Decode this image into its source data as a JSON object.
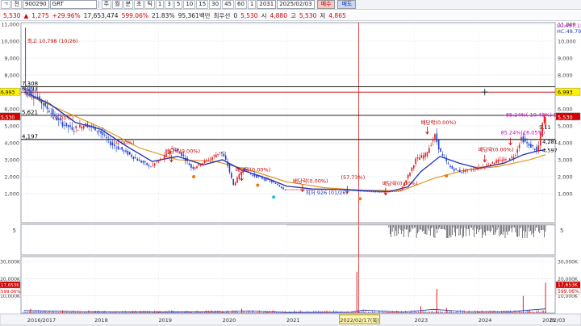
{
  "toolbar": {
    "items": [
      "ㄱ",
      "전",
      "900290",
      "GRT",
      "주",
      "월",
      "분",
      "초",
      "틱",
      "1",
      "3",
      "5",
      "10",
      "15",
      "30",
      "45",
      "60",
      "1",
      "2031",
      "2025/02/03"
    ],
    "trade_buy": "매수",
    "trade_sell": "매도"
  },
  "info": {
    "price": "5,530",
    "change": "1,275",
    "change_pct": "+29.96%",
    "volume": "17,653,474",
    "vol_ratio": "599.06%",
    "turnover": "21.83%",
    "amount": "95,361백만",
    "prio_label": "최우선",
    "prio_val": "0",
    "cur": "5,530",
    "open_label": "시",
    "open": "4,880",
    "high_label": "고",
    "high": "5,530",
    "low_label": "저",
    "low": "4,865"
  },
  "chart_data": {
    "type": "candlestick",
    "x_ticks": [
      "2016/2017",
      "2018",
      "2019",
      "2020",
      "2021",
      "2022/02/17(목)",
      "2023",
      "2024",
      "2025",
      "02/03"
    ],
    "y_ticks": [
      "11,000",
      "10,000",
      "9,000",
      "8,000",
      "7,000",
      "6,000",
      "5,000",
      "4,000",
      "3,000",
      "2,000",
      "1,000"
    ],
    "ylim": [
      0,
      11000
    ],
    "price_series": [
      [
        2016.9,
        7300
      ],
      [
        2017.1,
        6800
      ],
      [
        2017.3,
        6000
      ],
      [
        2017.5,
        5200
      ],
      [
        2017.7,
        4800
      ],
      [
        2017.9,
        5100
      ],
      [
        2018.1,
        4700
      ],
      [
        2018.3,
        3900
      ],
      [
        2018.5,
        3500
      ],
      [
        2018.7,
        3000
      ],
      [
        2018.9,
        2600
      ],
      [
        2019.1,
        3100
      ],
      [
        2019.25,
        3700
      ],
      [
        2019.4,
        3300
      ],
      [
        2019.55,
        2500
      ],
      [
        2019.7,
        2800
      ],
      [
        2019.85,
        3100
      ],
      [
        2020.0,
        3500
      ],
      [
        2020.1,
        2800
      ],
      [
        2020.2,
        1500
      ],
      [
        2020.35,
        2500
      ],
      [
        2020.5,
        2100
      ],
      [
        2020.65,
        1900
      ],
      [
        2020.8,
        1700
      ],
      [
        2020.9,
        1500
      ],
      [
        2021.0,
        1250
      ],
      [
        2021.3,
        1250
      ],
      [
        2021.6,
        1250
      ],
      [
        2021.9,
        1250
      ],
      [
        2022.2,
        1150
      ],
      [
        2022.5,
        1100
      ],
      [
        2022.8,
        1150
      ],
      [
        2022.95,
        2200
      ],
      [
        2023.05,
        3000
      ],
      [
        2023.2,
        3300
      ],
      [
        2023.35,
        4400
      ],
      [
        2023.45,
        3300
      ],
      [
        2023.6,
        2500
      ],
      [
        2023.75,
        2300
      ],
      [
        2023.9,
        2400
      ],
      [
        2024.1,
        2600
      ],
      [
        2024.3,
        2900
      ],
      [
        2024.5,
        3000
      ],
      [
        2024.6,
        3300
      ],
      [
        2024.7,
        4300
      ],
      [
        2024.8,
        3900
      ],
      [
        2024.9,
        3700
      ],
      [
        2024.95,
        3400
      ],
      [
        2025.05,
        5530
      ]
    ],
    "ma_series": [
      [
        2016.9,
        7000
      ],
      [
        2017.3,
        6300
      ],
      [
        2017.7,
        5200
      ],
      [
        2018.1,
        4800
      ],
      [
        2018.5,
        3800
      ],
      [
        2018.9,
        2900
      ],
      [
        2019.3,
        3200
      ],
      [
        2019.7,
        2700
      ],
      [
        2020.0,
        3000
      ],
      [
        2020.3,
        2400
      ],
      [
        2020.7,
        1900
      ],
      [
        2021.0,
        1450
      ],
      [
        2021.4,
        1280
      ],
      [
        2021.8,
        1250
      ],
      [
        2022.2,
        1180
      ],
      [
        2022.6,
        1120
      ],
      [
        2022.9,
        1400
      ],
      [
        2023.1,
        2300
      ],
      [
        2023.4,
        3200
      ],
      [
        2023.7,
        2800
      ],
      [
        2024.0,
        2500
      ],
      [
        2024.4,
        2800
      ],
      [
        2024.7,
        3300
      ],
      [
        2024.9,
        3500
      ],
      [
        2025.05,
        3600
      ]
    ],
    "ma_long_series": [
      [
        2016.9,
        6900
      ],
      [
        2017.5,
        5900
      ],
      [
        2018.1,
        4900
      ],
      [
        2018.7,
        3700
      ],
      [
        2019.3,
        3000
      ],
      [
        2019.9,
        2900
      ],
      [
        2020.5,
        2300
      ],
      [
        2021.0,
        1700
      ],
      [
        2021.6,
        1350
      ],
      [
        2022.2,
        1200
      ],
      [
        2022.8,
        1180
      ],
      [
        2023.3,
        1900
      ],
      [
        2023.8,
        2400
      ],
      [
        2024.3,
        2600
      ],
      [
        2024.8,
        3000
      ],
      [
        2025.05,
        3300
      ]
    ],
    "h_lines": [
      {
        "value": 7308,
        "label": "7,308",
        "color": "#000000"
      },
      {
        "value": 6993,
        "label": "6,993",
        "color": "#cc0000"
      },
      {
        "value": 5621,
        "label": "5,621",
        "color": "#000000"
      },
      {
        "value": 4197,
        "label": "4,197",
        "color": "#000000"
      }
    ],
    "right_badges": [
      {
        "value": 6993,
        "label": "6,993",
        "bg": "#fff200",
        "fg": "#000000"
      },
      {
        "value": 5530,
        "label": "5,530",
        "bg": "#d40000",
        "fg": "#ffffff"
      }
    ],
    "left_badges": [
      {
        "value": 6993,
        "label": "6,993",
        "bg": "#fff200",
        "fg": "#000000"
      },
      {
        "value": 5530,
        "label": "5,530",
        "bg": "#d40000",
        "fg": "#ffffff"
      }
    ],
    "annotations": [
      {
        "text": "최고 10,798 (10/26)",
        "x": 2016.95,
        "y": 9900,
        "color": "#c00000"
      },
      {
        "text": "최저 926 (01/26)",
        "x": 2021.3,
        "y": 950,
        "color": "#1f3fbf"
      },
      {
        "text": "(0.00%)",
        "x": 2017.35,
        "y": 5350,
        "color": "#c00000"
      },
      {
        "text": "(0.00%)",
        "x": 2018.3,
        "y": 3900,
        "color": "#c00000"
      },
      {
        "text": "배당락(0.00%)",
        "x": 2019.1,
        "y": 3400,
        "color": "#c00000"
      },
      {
        "text": "배당락(0.00%)",
        "x": 2020.2,
        "y": 2300,
        "color": "#c00000"
      },
      {
        "text": "배당락(0.00%)",
        "x": 2021.1,
        "y": 1650,
        "color": "#c00000"
      },
      {
        "text": "(57.73%)",
        "x": 2021.85,
        "y": 1850,
        "color": "#c00000"
      },
      {
        "text": "배당락(0.00%)",
        "x": 2022.5,
        "y": 1500,
        "color": "#c00000"
      },
      {
        "text": "배당락(0.00%)",
        "x": 2023.1,
        "y": 5100,
        "color": "#c00000"
      },
      {
        "text": "배당락(0.00%)",
        "x": 2024.0,
        "y": 3500,
        "color": "#c00000"
      },
      {
        "text": "85.24%(26.05%)",
        "x": 2024.35,
        "y": 4500,
        "color": "#cc00cc"
      },
      {
        "text": "-85.24%(-10.48%) 5,838",
        "x": 2024.4,
        "y": 5550,
        "color": "#cc00cc"
      },
      {
        "text": "5,11",
        "x": 2024.95,
        "y": 4800,
        "color": "#000000"
      },
      {
        "text": "4,281",
        "x": 2025.0,
        "y": 3950,
        "color": "#000000"
      },
      {
        "text": "4,597",
        "x": 2025.0,
        "y": 3450,
        "color": "#000000"
      }
    ],
    "volume_y_ticks": [
      "30,000K",
      "20,000K",
      "10,000K"
    ],
    "volume_ylim": [
      0,
      30000
    ],
    "volume_badges": [
      {
        "label": "17,653K",
        "bg": "#d40000",
        "fg": "#ffffff"
      },
      {
        "label": "599.06%",
        "bg": "#ffffff",
        "fg": "#d40000"
      }
    ],
    "volume_series": [
      [
        2017.0,
        2500
      ],
      [
        2017.5,
        900
      ],
      [
        2018.0,
        600
      ],
      [
        2018.6,
        1200
      ],
      [
        2019.0,
        700
      ],
      [
        2019.5,
        900
      ],
      [
        2020.0,
        1100
      ],
      [
        2020.3,
        2500
      ],
      [
        2020.7,
        800
      ],
      [
        2021.0,
        300
      ],
      [
        2022.1,
        24000
      ],
      [
        2022.6,
        600
      ],
      [
        2023.1,
        4000
      ],
      [
        2023.35,
        14000
      ],
      [
        2023.5,
        3000
      ],
      [
        2024.0,
        900
      ],
      [
        2024.7,
        10000
      ],
      [
        2024.8,
        2000
      ],
      [
        2025.05,
        17653
      ]
    ],
    "indicator_y_ticks": [
      "5"
    ],
    "top_right_text_1": "LC:497,15",
    "top_right_text_2": "HC:48.79"
  }
}
